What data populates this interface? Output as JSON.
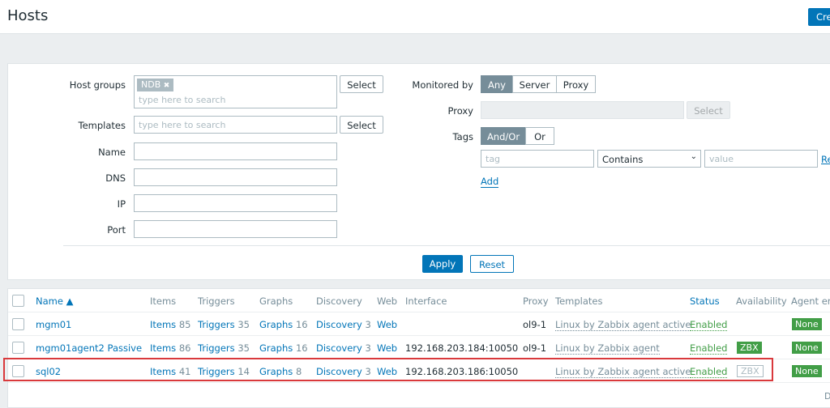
{
  "header": {
    "title": "Hosts",
    "create_label": "Cre"
  },
  "filter": {
    "host_groups_label": "Host groups",
    "host_group_chip": "NDB",
    "chip_remove": "✖",
    "search_placeholder": "type here to search",
    "select_label": "Select",
    "templates_label": "Templates",
    "name_label": "Name",
    "dns_label": "DNS",
    "ip_label": "IP",
    "port_label": "Port",
    "monitored_by_label": "Monitored by",
    "monitored_by_options": [
      "Any",
      "Server",
      "Proxy"
    ],
    "monitored_by_selected": "Any",
    "proxy_label": "Proxy",
    "tags_label": "Tags",
    "tags_options": [
      "And/Or",
      "Or"
    ],
    "tags_selected": "And/Or",
    "tag_placeholder": "tag",
    "tag_operator": "Contains",
    "value_placeholder": "value",
    "remove_label": "Re",
    "add_label": "Add",
    "apply_label": "Apply",
    "reset_label": "Reset"
  },
  "table": {
    "columns": {
      "name": "Name ▲",
      "items": "Items",
      "triggers": "Triggers",
      "graphs": "Graphs",
      "discovery": "Discovery",
      "web": "Web",
      "interface": "Interface",
      "proxy": "Proxy",
      "templates": "Templates",
      "status": "Status",
      "availability": "Availability",
      "agent_enc": "Agent enc"
    },
    "rows": [
      {
        "name": "mgm01",
        "items_label": "Items",
        "items": "85",
        "triggers_label": "Triggers",
        "triggers": "35",
        "graphs_label": "Graphs",
        "graphs": "16",
        "discovery_label": "Discovery",
        "discovery": "3",
        "web": "Web",
        "interface": "",
        "proxy": "ol9-1",
        "templates": "Linux by Zabbix agent active",
        "status": "Enabled",
        "availability": "",
        "agent_enc": "None"
      },
      {
        "name": "mgm01agent2 Passive",
        "items_label": "Items",
        "items": "86",
        "triggers_label": "Triggers",
        "triggers": "35",
        "graphs_label": "Graphs",
        "graphs": "16",
        "discovery_label": "Discovery",
        "discovery": "3",
        "web": "Web",
        "interface": "192.168.203.184:10050",
        "proxy": "ol9-1",
        "templates": "Linux by Zabbix agent",
        "status": "Enabled",
        "availability": "ZBX",
        "agent_enc": "None"
      },
      {
        "name": "sql02",
        "items_label": "Items",
        "items": "41",
        "triggers_label": "Triggers",
        "triggers": "14",
        "graphs_label": "Graphs",
        "graphs": "8",
        "discovery_label": "Discovery",
        "discovery": "3",
        "web": "Web",
        "interface": "192.168.203.186:10050",
        "proxy": "",
        "templates": "Linux by Zabbix agent active",
        "status": "Enabled",
        "availability": "ZBX",
        "agent_enc": "None"
      }
    ],
    "footer_text": "D"
  },
  "colors": {
    "accent": "#0275b8",
    "enabled": "#429e47",
    "highlight": "#d9393c",
    "muted": "#768d99"
  }
}
